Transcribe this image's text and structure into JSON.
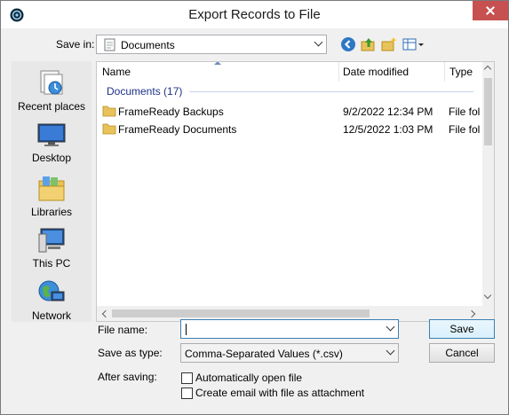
{
  "dialog": {
    "title": "Export Records to File"
  },
  "save_in": {
    "label": "Save in:",
    "value": "Documents",
    "icons": [
      "back-arrow-icon",
      "up-folder-icon",
      "new-folder-icon",
      "view-menu-icon"
    ]
  },
  "places": [
    {
      "label": "Recent places",
      "icon": "recent-places-icon"
    },
    {
      "label": "Desktop",
      "icon": "desktop-icon"
    },
    {
      "label": "Libraries",
      "icon": "libraries-icon"
    },
    {
      "label": "This PC",
      "icon": "this-pc-icon"
    },
    {
      "label": "Network",
      "icon": "network-icon"
    }
  ],
  "file_list": {
    "columns": [
      "Name",
      "Date modified",
      "Type"
    ],
    "group_header": "Documents (17)",
    "rows": [
      {
        "name": "FrameReady Backups",
        "date": "9/2/2022 12:34 PM",
        "type": "File fol"
      },
      {
        "name": "FrameReady Documents",
        "date": "12/5/2022 1:03 PM",
        "type": "File fol"
      }
    ]
  },
  "form": {
    "file_name_label": "File name:",
    "file_name_value": "",
    "save_as_type_label": "Save as type:",
    "save_as_type_value": "Comma-Separated Values (*.csv)",
    "after_saving_label": "After saving:",
    "options": [
      {
        "label": "Automatically open file",
        "checked": false
      },
      {
        "label": "Create email with file as attachment",
        "checked": false
      }
    ]
  },
  "buttons": {
    "save": "Save",
    "cancel": "Cancel"
  },
  "colors": {
    "close_button": "#c75050",
    "group_header": "#1e3287",
    "folder": "#e8c25a"
  }
}
